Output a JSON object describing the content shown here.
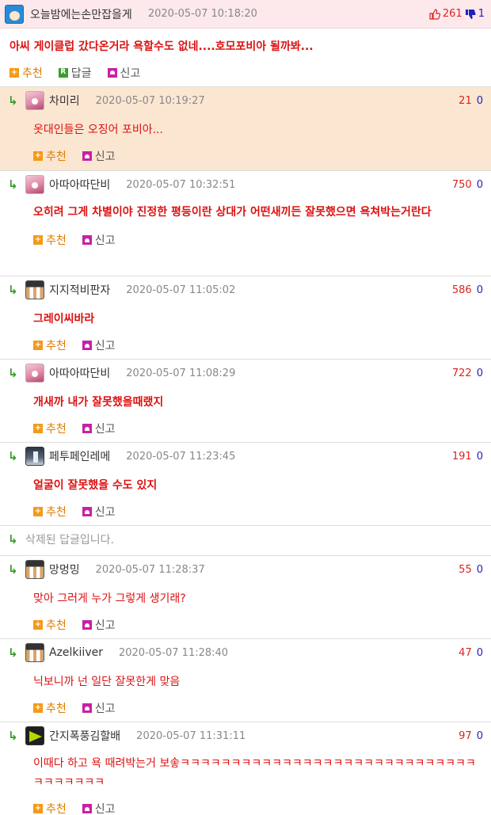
{
  "root": {
    "author": "오늘밤에는손만잡을게",
    "time": "2020-05-07 10:18:20",
    "up": "261",
    "down": "1",
    "text": "아씨 게이클럽 갔다온거라 욕할수도 없네....호모포비아 될까봐...",
    "recommend_label": "추천",
    "reply_label": "답글",
    "reply_icon": "R",
    "report_label": "신고"
  },
  "replies": [
    {
      "author": "차미리",
      "time": "2020-05-07 10:19:27",
      "up": "21",
      "down": "0",
      "text": "옷대인들은 오징어 포비아...",
      "recommend_label": "추천",
      "report_label": "신고"
    },
    {
      "author": "아따아따단비",
      "time": "2020-05-07 10:32:51",
      "up": "750",
      "down": "0",
      "text": "오히려 그게 차별이야 진정한 평등이란 상대가 어떤새끼든 잘못했으면 욕쳐박는거란다",
      "recommend_label": "추천",
      "report_label": "신고"
    },
    {
      "author": "지지적비판자",
      "time": "2020-05-07 11:05:02",
      "up": "586",
      "down": "0",
      "text": "그레이씨바라",
      "recommend_label": "추천",
      "report_label": "신고"
    },
    {
      "author": "아따아따단비",
      "time": "2020-05-07 11:08:29",
      "up": "722",
      "down": "0",
      "text": "개새까 내가 잘못했을때랬지",
      "recommend_label": "추천",
      "report_label": "신고"
    },
    {
      "author": "페투페인레메",
      "time": "2020-05-07 11:23:45",
      "up": "191",
      "down": "0",
      "text": "얼굴이 잘못했을 수도 있지",
      "recommend_label": "추천",
      "report_label": "신고"
    },
    {
      "deleted_text": "삭제된 답글입니다."
    },
    {
      "author": "망멍밍",
      "time": "2020-05-07 11:28:37",
      "up": "55",
      "down": "0",
      "text": "맞아 그러게 누가 그렇게 생기래?",
      "recommend_label": "추천",
      "report_label": "신고"
    },
    {
      "author": "Azelkiiver",
      "time": "2020-05-07 11:28:40",
      "up": "47",
      "down": "0",
      "text": "닉보니까 넌 일단 잘못한게 맞음",
      "recommend_label": "추천",
      "report_label": "신고"
    },
    {
      "author": "간지폭풍김할배",
      "time": "2020-05-07 11:31:11",
      "up": "97",
      "down": "0",
      "text": "이때다 하고 욕 때려박는거 보솧ㅋㅋㅋㅋㅋㅋㅋㅋㅋㅋㅋㅋㅋㅋㅋㅋㅋㅋㅋㅋㅋㅋㅋㅋㅋㅋㅋㅋㅋㅋㅋㅋㅋㅋㅋㅋ",
      "recommend_label": "추천",
      "report_label": "신고"
    }
  ],
  "colors": {
    "accent_red": "#dd1111",
    "reply_arrow": "#3a9a2a",
    "highlight_bg": "#fbe6d2",
    "root_bg": "#fde9ec"
  },
  "icons": [
    "avatar-icon",
    "thumb-up-icon",
    "thumb-down-icon",
    "plus-icon",
    "reply-icon",
    "report-icon",
    "reply-arrow-icon"
  ]
}
